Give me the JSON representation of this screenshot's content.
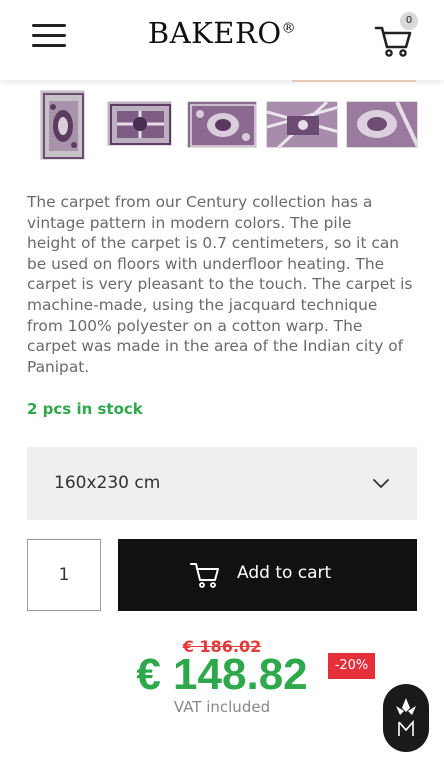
{
  "header": {
    "brand": "BAKERO",
    "brand_mark": "®",
    "cart_count": "0",
    "icons": {
      "menu": "hamburger-menu-icon",
      "cart": "shopping-cart-icon"
    }
  },
  "gallery": {
    "thumbnails": [
      "carpet-thumbnail-1",
      "carpet-thumbnail-2",
      "carpet-thumbnail-3",
      "carpet-thumbnail-4",
      "carpet-thumbnail-5"
    ]
  },
  "product": {
    "description_lines": [
      "The carpet from our Century collection has a",
      "vintage pattern in modern colors. The pile",
      "height of the carpet is 0.7 centimeters, so it can",
      "be used on floors with underfloor heating. The",
      "carpet is very pleasant to the touch. The carpet is",
      "machine-made, using the jacquard technique",
      "from 100% polyester on a cotton warp. The",
      "carpet was made in the area of the Indian city of",
      "Panipat."
    ],
    "stock": "2 pcs in stock",
    "size": {
      "selected": "160x230 cm",
      "icon": "chevron-down-icon"
    },
    "quantity": "1",
    "add_to_cart": "Add to cart",
    "price": {
      "old": "€ 186.02",
      "new": "€ 148.82",
      "discount": "-20%",
      "vat": "VAT included"
    }
  },
  "colors": {
    "accent_green": "#2da84a",
    "sale_red": "#e5303a",
    "button_black": "#111111",
    "select_bg": "#efefef"
  },
  "widgets": {
    "chat_icon": "chat-assistant-icon"
  }
}
